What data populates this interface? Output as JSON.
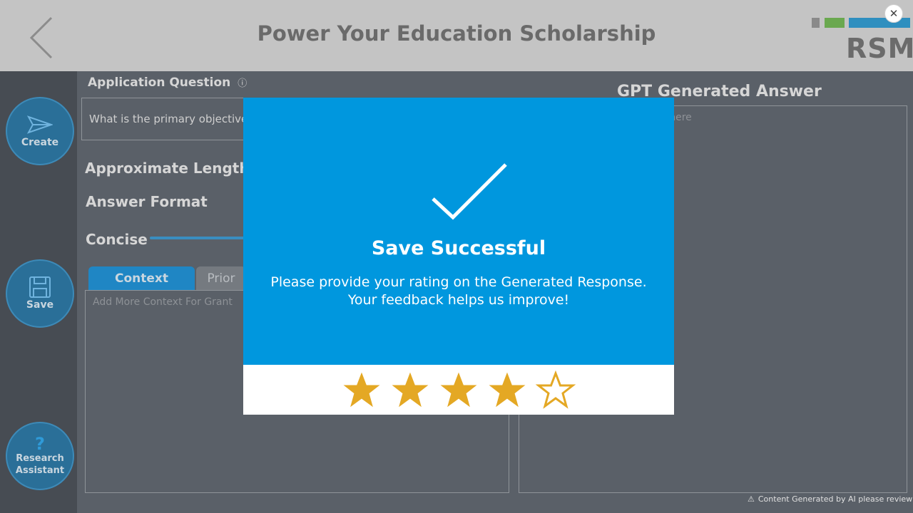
{
  "header": {
    "title": "Power Your Education Scholarship",
    "logo_text": "RSM",
    "logo_colors": [
      "#8a8a8a",
      "#6aa84f",
      "#2f8fbf"
    ],
    "back_icon": "chevron-left-icon",
    "close_icon": "close-icon",
    "close_glyph": "✕"
  },
  "rail": {
    "create_label": "Create",
    "save_label": "Save",
    "research_label": "Research Assistant",
    "research_glyph": "?"
  },
  "main": {
    "question_label": "Application Question",
    "question_info_glyph": "ⓘ",
    "question_value": "What is the primary objective",
    "approx_length_label": "Approximate Length",
    "answer_format_label": "Answer Format",
    "concise_label": "Concise",
    "tabs": [
      {
        "label": "Context",
        "active": true
      },
      {
        "label": "Prior",
        "active": false
      }
    ],
    "context_placeholder": "Add More Context For Grant",
    "gpt_answer_label": "GPT Generated Answer",
    "gpt_answer_placeholder": "r here",
    "footer_note": "Content Generated by AI please review",
    "footer_warning_glyph": "⚠"
  },
  "modal": {
    "title": "Save Successful",
    "message_line1": "Please provide your rating on the Generated Response.",
    "message_line2": "Your feedback helps us improve!",
    "rating": 4,
    "rating_max": 5,
    "colors": {
      "background": "#0097de",
      "star": "#e4a824"
    }
  }
}
